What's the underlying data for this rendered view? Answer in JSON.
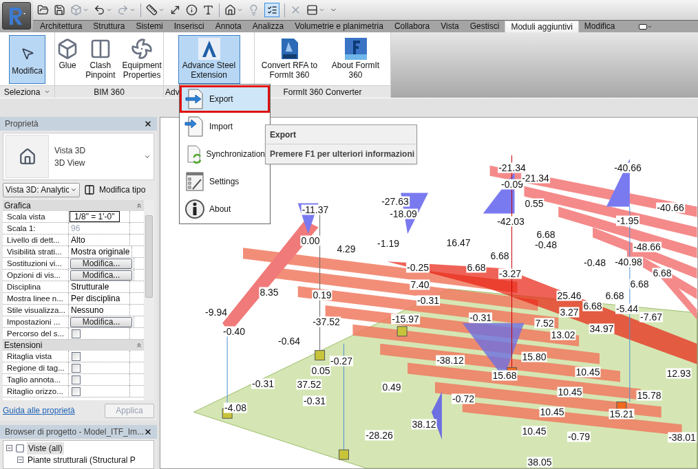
{
  "ribbon_tabs": [
    {
      "label": "Architettura",
      "selected": false
    },
    {
      "label": "Struttura",
      "selected": false
    },
    {
      "label": "Sistemi",
      "selected": false
    },
    {
      "label": "Inserisci",
      "selected": false
    },
    {
      "label": "Annota",
      "selected": false
    },
    {
      "label": "Analizza",
      "selected": false
    },
    {
      "label": "Volumetrie e planimetria",
      "selected": false
    },
    {
      "label": "Collabora",
      "selected": false
    },
    {
      "label": "Vista",
      "selected": false
    },
    {
      "label": "Gestisci",
      "selected": false
    },
    {
      "label": "Moduli aggiuntivi",
      "selected": true
    },
    {
      "label": "Modifica",
      "selected": false
    }
  ],
  "ribbon_panels": [
    {
      "title": "Seleziona",
      "has_menu": true,
      "buttons": [
        {
          "label": "Modifica",
          "kind": "pointer",
          "selected": true
        }
      ]
    },
    {
      "title": "BIM 360",
      "has_menu": false,
      "buttons": [
        {
          "label": "Glue",
          "kind": "cubes",
          "selected": false
        },
        {
          "label": "Clash Pinpoint",
          "kind": "squares",
          "selected": false
        },
        {
          "label": "Equipment Properties",
          "kind": "fan",
          "selected": false
        }
      ]
    },
    {
      "title": "Adv",
      "has_menu": false,
      "buttons": [
        {
          "label": "Advance Steel Extension",
          "kind": "steel",
          "selected": true
        }
      ]
    },
    {
      "title": "FormIt 360 Converter",
      "has_menu": false,
      "buttons": [
        {
          "label": "Convert RFA to FormIt 360",
          "kind": "rfa",
          "selected": false
        },
        {
          "label": "About FormIt 360",
          "kind": "formit",
          "selected": false
        }
      ]
    }
  ],
  "dropdown_menu": {
    "items": [
      {
        "label": "Export",
        "kind": "export",
        "selected": true
      },
      {
        "label": "Import",
        "kind": "import",
        "selected": false
      },
      {
        "label": "Synchronization",
        "kind": "sync",
        "selected": false
      },
      {
        "label": "Settings",
        "kind": "settings",
        "selected": false
      },
      {
        "label": "About",
        "kind": "about",
        "selected": false
      }
    ]
  },
  "tooltip": {
    "title": "Export",
    "hint": "Premere F1 per ulteriori informazioni"
  },
  "properties": {
    "title": "Proprietà",
    "type_name": "Vista 3D",
    "type_subname": "3D View",
    "view_selector": "Vista 3D: Analytic",
    "edit_type": "Modifica tipo",
    "groups": [
      {
        "title": "Grafica",
        "rows": [
          {
            "label": "Scala vista",
            "kind": "input",
            "value": "1/8\" = 1'-0\""
          },
          {
            "label": "Scala 1:",
            "kind": "text",
            "value": "96",
            "disabled": true
          },
          {
            "label": "Livello di dett...",
            "kind": "text",
            "value": "Alto",
            "disabled": false
          },
          {
            "label": "Visibilità strati...",
            "kind": "text",
            "value": "Mostra originale",
            "disabled": false
          },
          {
            "label": "Sostituzioni vi...",
            "kind": "button",
            "value": "Modifica...",
            "disabled": false
          },
          {
            "label": "Opzioni di vis...",
            "kind": "button",
            "value": "Modifica...",
            "disabled": false
          },
          {
            "label": "Disciplina",
            "kind": "text",
            "value": "Strutturale",
            "disabled": false
          },
          {
            "label": "Mostra linee n...",
            "kind": "text",
            "value": "Per disciplina",
            "disabled": false
          },
          {
            "label": "Stile visualizza...",
            "kind": "text",
            "value": "Nessuno",
            "disabled": false
          },
          {
            "label": "Impostazioni ...",
            "kind": "button",
            "value": "Modifica...",
            "disabled": false
          },
          {
            "label": "Percorso del s...",
            "kind": "checkbox",
            "checked": false
          }
        ]
      },
      {
        "title": "Estensioni",
        "rows": [
          {
            "label": "Ritaglia vista",
            "kind": "checkbox",
            "checked": false
          },
          {
            "label": "Regione di tag...",
            "kind": "checkbox",
            "checked": false
          },
          {
            "label": "Taglio annota...",
            "kind": "checkbox",
            "checked": false
          },
          {
            "label": "Ritaglio orizzo...",
            "kind": "checkbox",
            "checked": false
          }
        ]
      }
    ],
    "help_link": "Guida alle proprietà",
    "apply_button": {
      "label": "Applica",
      "disabled": true
    }
  },
  "project_browser": {
    "title": "Browser di progetto - Model_ITF_Im...",
    "tree": [
      {
        "label": "Viste (all)",
        "expanded": true,
        "children": [
          {
            "label": "Piante strutturali (Structural P",
            "expanded": true
          }
        ]
      }
    ]
  },
  "viewport_labels": [
    "-21.34",
    "-0.09",
    "-21.34",
    "-40.66",
    "-40.66",
    "-27.63",
    "-18.09",
    "-11.37",
    "0.55",
    "-1.95",
    "-42.03",
    "6.68",
    "16.47",
    "-0.48",
    "0.00",
    "4.29",
    "-1.19",
    "-48.66",
    "-0.48",
    "-40.98",
    "6.68",
    "6.68",
    "6.68",
    "-0.25",
    "6.68",
    "8.35",
    "0.19",
    "-3.27",
    "7.40",
    "-0.31",
    "25.46",
    "6.68",
    "6.68",
    "3.27",
    "-5.44",
    "-9.94",
    "-37.52",
    "-15.97",
    "-0.31",
    "13.02",
    "34.97",
    "-0.40",
    "-0.64",
    "-0.27",
    "-38.12",
    "15.80",
    "10.45",
    "12.93",
    "0.05",
    "37.52",
    "0.49",
    "15.68",
    "-0.31",
    "-0.31",
    "-4.08",
    "-0.72",
    "10.45",
    "15.78",
    "10.45",
    "15.21",
    "-28.26",
    "38.12",
    "10.45",
    "-0.79",
    "-38.01",
    "38.05",
    "-7.67",
    "7.52"
  ]
}
